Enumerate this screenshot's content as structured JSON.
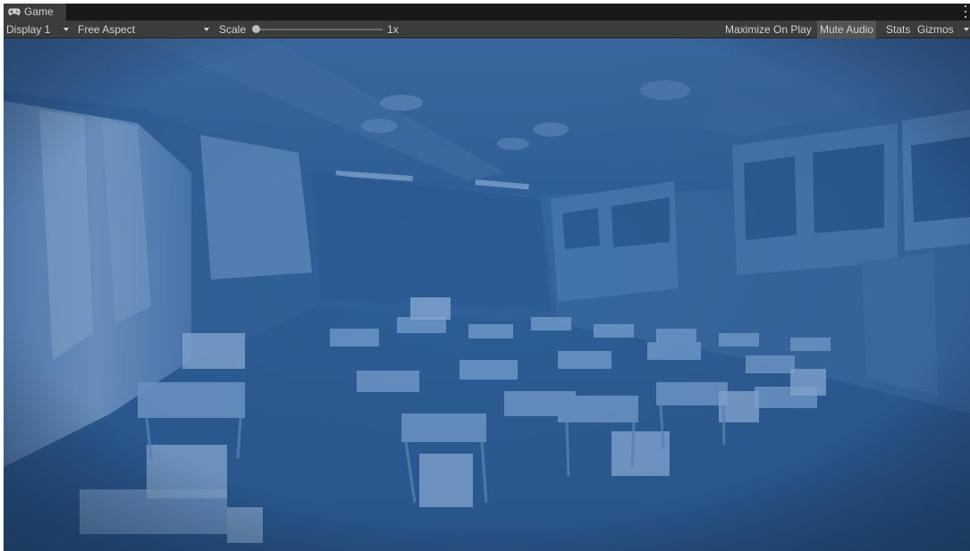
{
  "window": {
    "tab_title": "Game",
    "tab_icon": "gamepad-icon"
  },
  "toolbar": {
    "display": "Display 1",
    "aspect": "Free Aspect",
    "scale_label": "Scale",
    "scale_value": "1x",
    "scale_fraction": 0.0,
    "maximize_on_play": "Maximize On Play",
    "mute_audio": "Mute Audio",
    "stats": "Stats",
    "gizmos": "Gizmos"
  },
  "colors": {
    "tint": "#2a5a93",
    "toolbar_bg": "#3c3c3c",
    "tabbar_bg": "#191919"
  }
}
